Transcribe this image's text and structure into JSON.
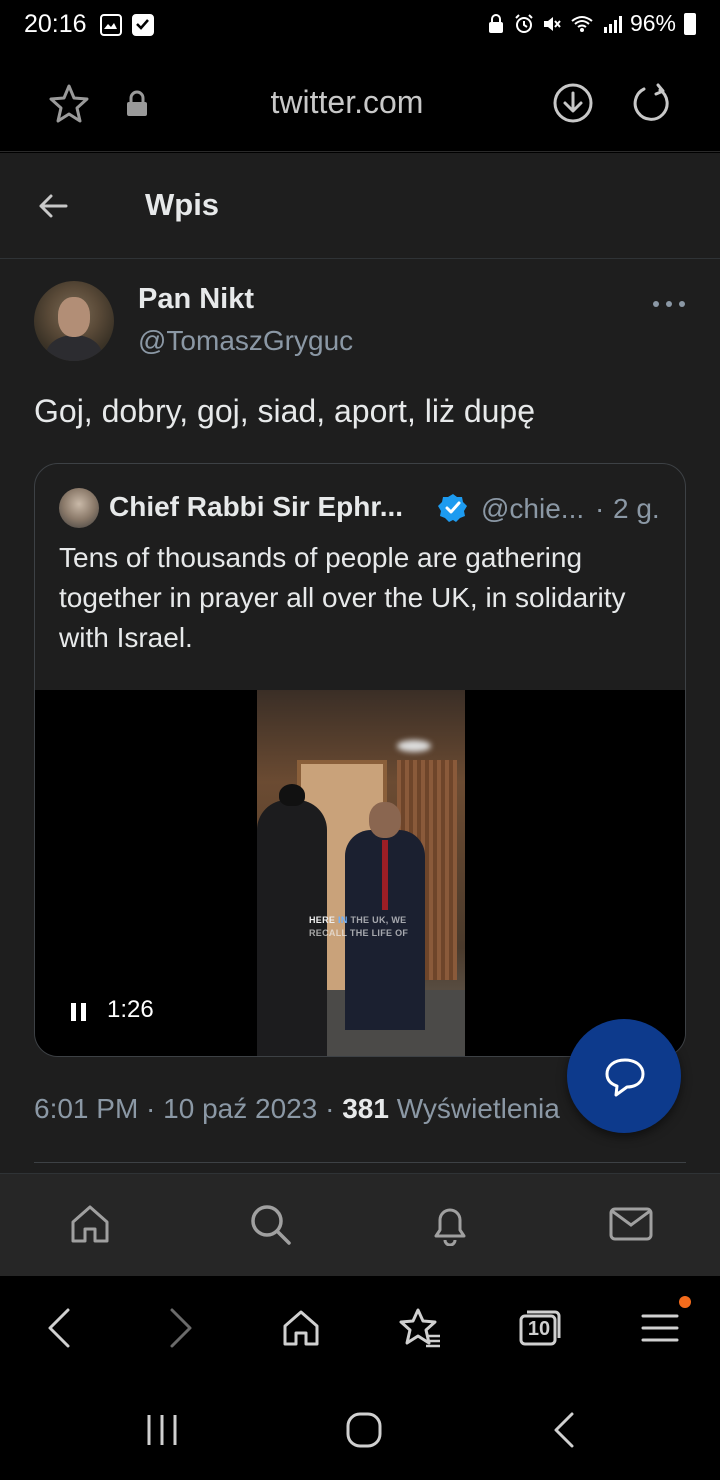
{
  "status_bar": {
    "time": "20:16",
    "battery": "96%"
  },
  "browser": {
    "url": "twitter.com"
  },
  "page": {
    "title": "Wpis"
  },
  "tweet": {
    "author_name": "Pan Nikt",
    "author_handle": "@TomaszGryguc",
    "text": "Goj, dobry, goj, siad, aport, liż dupę",
    "timestamp": "6:01 PM · 10 paź 2023",
    "views_sep": "·",
    "views_count": "381",
    "views_label": "Wyświetlenia"
  },
  "quote": {
    "author_name": "Chief Rabbi Sir Ephr...",
    "author_handle": "@chie...",
    "separator": "·",
    "time": "2 g.",
    "text": "Tens of thousands of people are gathering together in prayer all over the UK, in solidarity with Israel.",
    "video": {
      "caption_line1_white": "HERE",
      "caption_line1_blue": "IN",
      "caption_line1_rest": "THE UK, WE",
      "caption_line2": "RECALL THE LIFE OF",
      "duration": "1:26"
    }
  },
  "browser_tabs_count": "10",
  "colors": {
    "accent": "#1d9bf0",
    "fab": "#0d3a8c",
    "notification_dot": "#f36b1c",
    "background": "#1e1e1e"
  }
}
